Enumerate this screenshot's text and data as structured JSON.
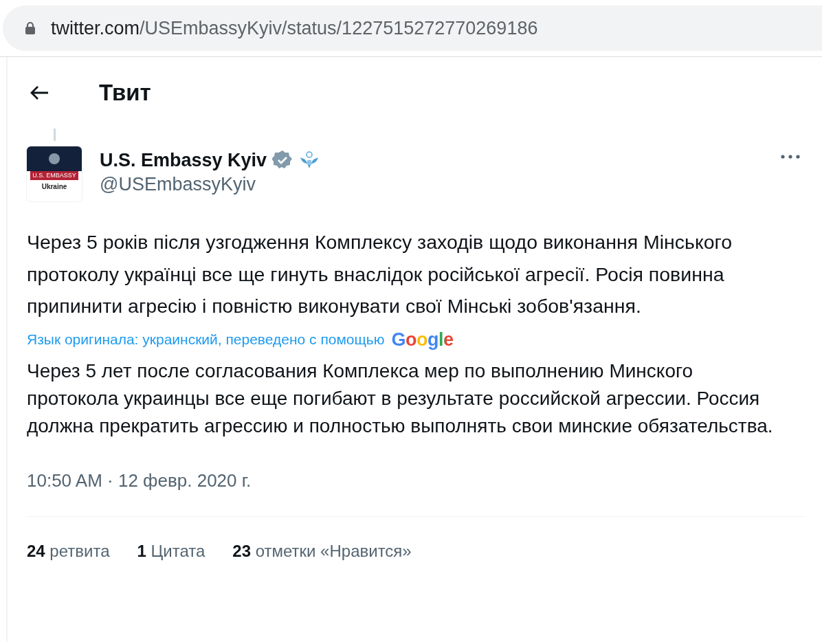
{
  "address_bar": {
    "domain": "twitter.com",
    "path": "/USEmbassyKyiv/status/1227515272770269186"
  },
  "header": {
    "title": "Твит"
  },
  "author": {
    "name": "U.S. Embassy Kyiv",
    "handle": "@USEmbassyKyiv",
    "verified": true,
    "avatar_band": "U.S. EMBASSY",
    "avatar_caption": "Ukraine"
  },
  "tweet": {
    "text": "Через 5 років після узгодження Комплексу заходів щодо виконання Мінського протоколу українці все ще гинуть внаслідок російської агресії. Росія повинна припинити агресію і повністю виконувати свої Мінські зобов'язання.",
    "translation_note": "Язык оригинала: украинский, переведено с помощью",
    "translation_logo": "Google",
    "translation": "Через 5 лет после согласования Комплекса мер по выполнению Минского протокола украинцы все еще погибают в результате российской агрессии. Россия должна прекратить агрессию и полностью выполнять свои минские обязательства.",
    "timestamp": "10:50 AM · 12 февр. 2020 г."
  },
  "stats": [
    "**24** ретвита",
    "**1** Цитата",
    "**23** отметки «Нравится»"
  ]
}
